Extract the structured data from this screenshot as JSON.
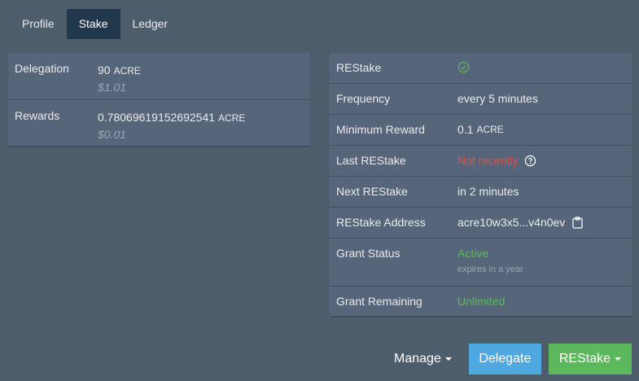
{
  "tabs": [
    {
      "label": "Profile"
    },
    {
      "label": "Stake"
    },
    {
      "label": "Ledger"
    }
  ],
  "left": {
    "delegation": {
      "label": "Delegation",
      "amount": "90",
      "unit": "ACRE",
      "usd": "$1.01"
    },
    "rewards": {
      "label": "Rewards",
      "amount": "0.78069619152692541",
      "unit": "ACRE",
      "usd": "$0.01"
    }
  },
  "right": {
    "restake": {
      "label": "REStake",
      "icon": "check-circle-icon"
    },
    "frequency": {
      "label": "Frequency",
      "value": "every 5 minutes"
    },
    "minimum_reward": {
      "label": "Minimum Reward",
      "amount": "0.1",
      "unit": "ACRE"
    },
    "last_restake": {
      "label": "Last REStake",
      "value": "Not recently",
      "icon": "question-circle-icon"
    },
    "next_restake": {
      "label": "Next REStake",
      "value": "in 2 minutes"
    },
    "restake_address": {
      "label": "REStake Address",
      "value": "acre10w3x5...v4n0ev",
      "icon": "clipboard-icon"
    },
    "grant_status": {
      "label": "Grant Status",
      "value": "Active",
      "sub": "expires in a year"
    },
    "grant_remaining": {
      "label": "Grant Remaining",
      "value": "Unlimited"
    }
  },
  "actions": {
    "manage_label": "Manage",
    "delegate_label": "Delegate",
    "restake_label": "REStake"
  },
  "colors": {
    "background": "#4e5d6c",
    "active_tab": "#20374c",
    "danger": "#d9534f",
    "success": "#5cb85c",
    "primary": "#4fa8e0"
  }
}
